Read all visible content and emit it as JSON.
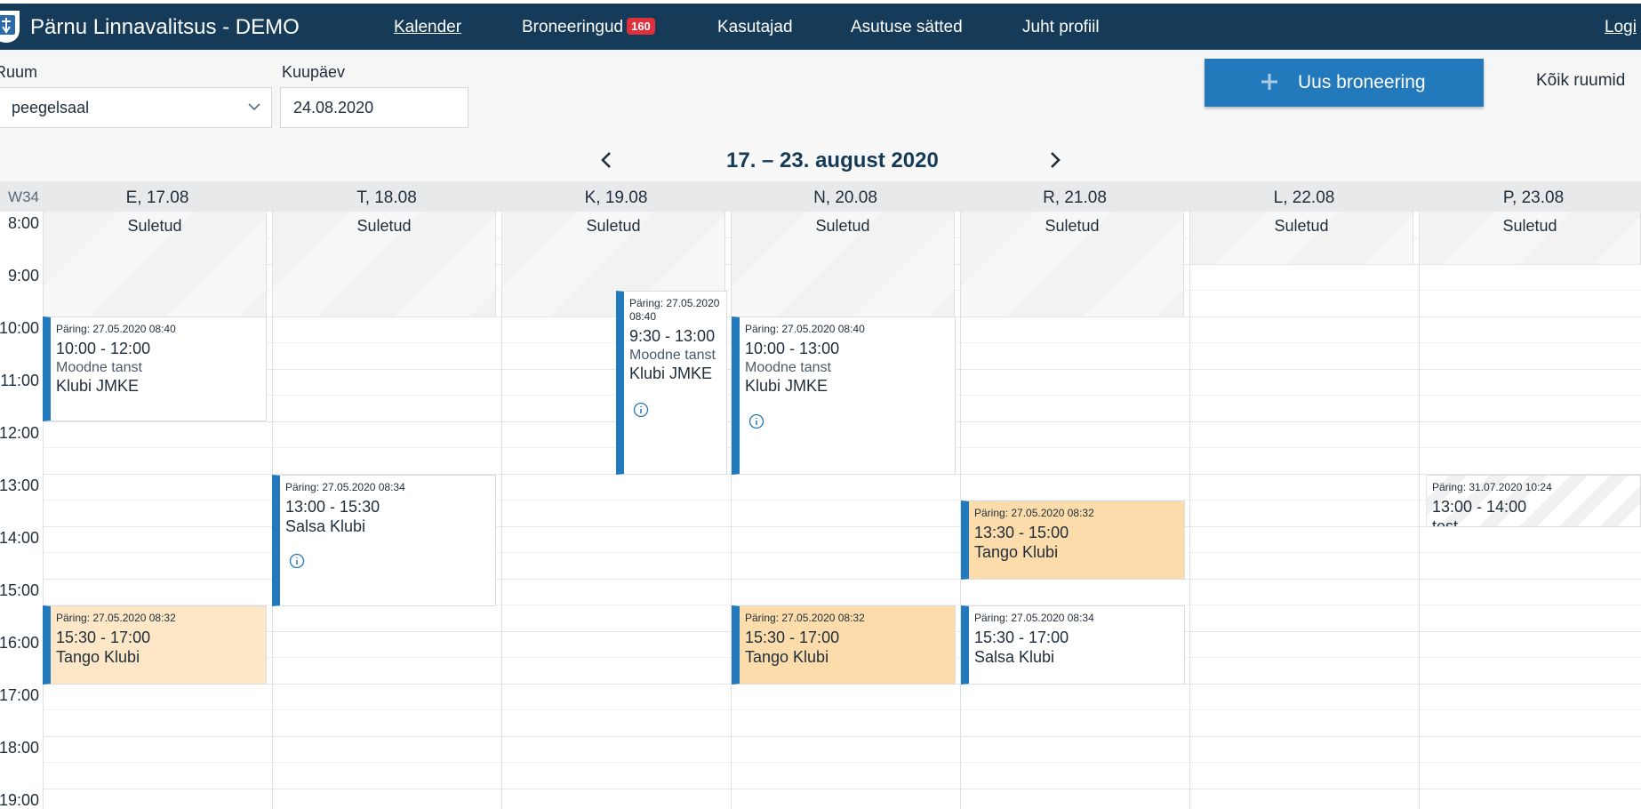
{
  "app": {
    "title": "Pärnu Linnavalitsus - DEMO"
  },
  "nav": {
    "calendar": "Kalender",
    "bookings": "Broneeringud",
    "bookings_badge": "160",
    "users": "Kasutajad",
    "settings": "Asutuse sätted",
    "profile": "Juht profiil",
    "login": "Logi"
  },
  "filters": {
    "room_label": "Ruum",
    "room_value": "peegelsaal",
    "date_label": "Kuupäev",
    "date_value": "24.08.2020",
    "new_booking": "Uus broneering",
    "all_rooms": "Kõik ruumid"
  },
  "week": {
    "range": "17. – 23. august 2020",
    "number": "W34",
    "days": [
      "E, 17.08",
      "T, 18.08",
      "K, 19.08",
      "N, 20.08",
      "R, 21.08",
      "L, 22.08",
      "P, 23.08"
    ],
    "hours": [
      "8:00",
      "9:00",
      "10:00",
      "11:00",
      "12:00",
      "13:00",
      "14:00",
      "15:00",
      "16:00",
      "17:00",
      "18:00",
      "19:00"
    ]
  },
  "closed_label": "Suletud",
  "events": [
    {
      "req": "Päring: 27.05.2020 08:40",
      "time": "10:00 - 12:00",
      "type": "Moodne tanst",
      "club": "Klubi JMKE"
    },
    {
      "req": "Päring: 27.05.2020 08:34",
      "time": "13:00 - 15:30",
      "type": "",
      "club": "Salsa Klubi"
    },
    {
      "req": "Päring: 27.05.2020 08:40",
      "time": "9:30 - 13:00",
      "type": "Moodne tanst",
      "club": "Klubi JMKE"
    },
    {
      "req": "Päring: 27.05.2020 08:40",
      "time": "10:00 - 13:00",
      "type": "Moodne tanst",
      "club": "Klubi JMKE"
    },
    {
      "req": "Päring: 27.05.2020 08:32",
      "time": "13:30 - 15:00",
      "type": "",
      "club": "Tango Klubi"
    },
    {
      "req": "Päring: 31.07.2020 10:24",
      "time": "13:00 - 14:00",
      "type": "",
      "club": "test"
    },
    {
      "req": "Päring: 27.05.2020 08:32",
      "time": "15:30 - 17:00",
      "type": "",
      "club": "Tango Klubi"
    },
    {
      "req": "Päring: 27.05.2020 08:32",
      "time": "15:30 - 17:00",
      "type": "",
      "club": "Tango Klubi"
    },
    {
      "req": "Päring: 27.05.2020 08:34",
      "time": "15:30 - 17:00",
      "type": "",
      "club": "Salsa Klubi"
    }
  ],
  "colors": {
    "topbar": "#153b58",
    "accent": "#2279bb",
    "badge": "#e0303b",
    "tango": "#fcdcab"
  }
}
